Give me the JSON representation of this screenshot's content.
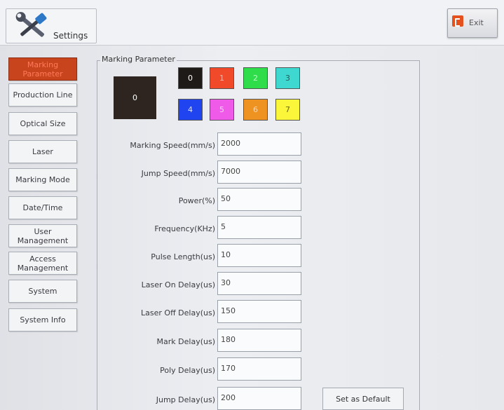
{
  "header": {
    "settings_label": "Settings",
    "exit_label": "Exit"
  },
  "sidebar": {
    "items": [
      {
        "label": "Marking Parameter",
        "active": true
      },
      {
        "label": "Production Line"
      },
      {
        "label": "Optical Size"
      },
      {
        "label": "Laser"
      },
      {
        "label": "Marking Mode"
      },
      {
        "label": "Date/Time"
      },
      {
        "label": "User Management"
      },
      {
        "label": "Access Management"
      },
      {
        "label": "System"
      },
      {
        "label": "System Info"
      }
    ]
  },
  "panel": {
    "title": "Marking Parameter",
    "selected_color": "0",
    "swatches": [
      {
        "label": "0",
        "color": "#1e1a18",
        "text_color": "#ffffff"
      },
      {
        "label": "1",
        "color": "#f04a2a",
        "text_color": "#ffb0a0"
      },
      {
        "label": "2",
        "color": "#2fdc4a",
        "text_color": "#b8ffc0"
      },
      {
        "label": "3",
        "color": "#3ed8d0",
        "text_color": "#1e5e5a"
      },
      {
        "label": "4",
        "color": "#1f44f0",
        "text_color": "#d8e0ff"
      },
      {
        "label": "5",
        "color": "#f05ae8",
        "text_color": "#ffd0fb"
      },
      {
        "label": "6",
        "color": "#ee9222",
        "text_color": "#ffd8a8"
      },
      {
        "label": "7",
        "color": "#fbf63a",
        "text_color": "#6a6a10"
      }
    ],
    "fields": [
      {
        "label": "Marking Speed(mm/s)",
        "value": "2000"
      },
      {
        "label": "Jump Speed(mm/s)",
        "value": "7000"
      },
      {
        "label": "Power(%)",
        "value": "50"
      },
      {
        "label": "Frequency(KHz)",
        "value": "5"
      },
      {
        "label": "Pulse Length(us)",
        "value": "10"
      },
      {
        "label": "Laser On Delay(us)",
        "value": "30"
      },
      {
        "label": "Laser Off Delay(us)",
        "value": "150"
      },
      {
        "label": "Mark Delay(us)",
        "value": "180"
      },
      {
        "label": "Poly Delay(us)",
        "value": "170"
      },
      {
        "label": "Jump Delay(us)",
        "value": "200"
      }
    ],
    "default_button": "Set as Default"
  }
}
